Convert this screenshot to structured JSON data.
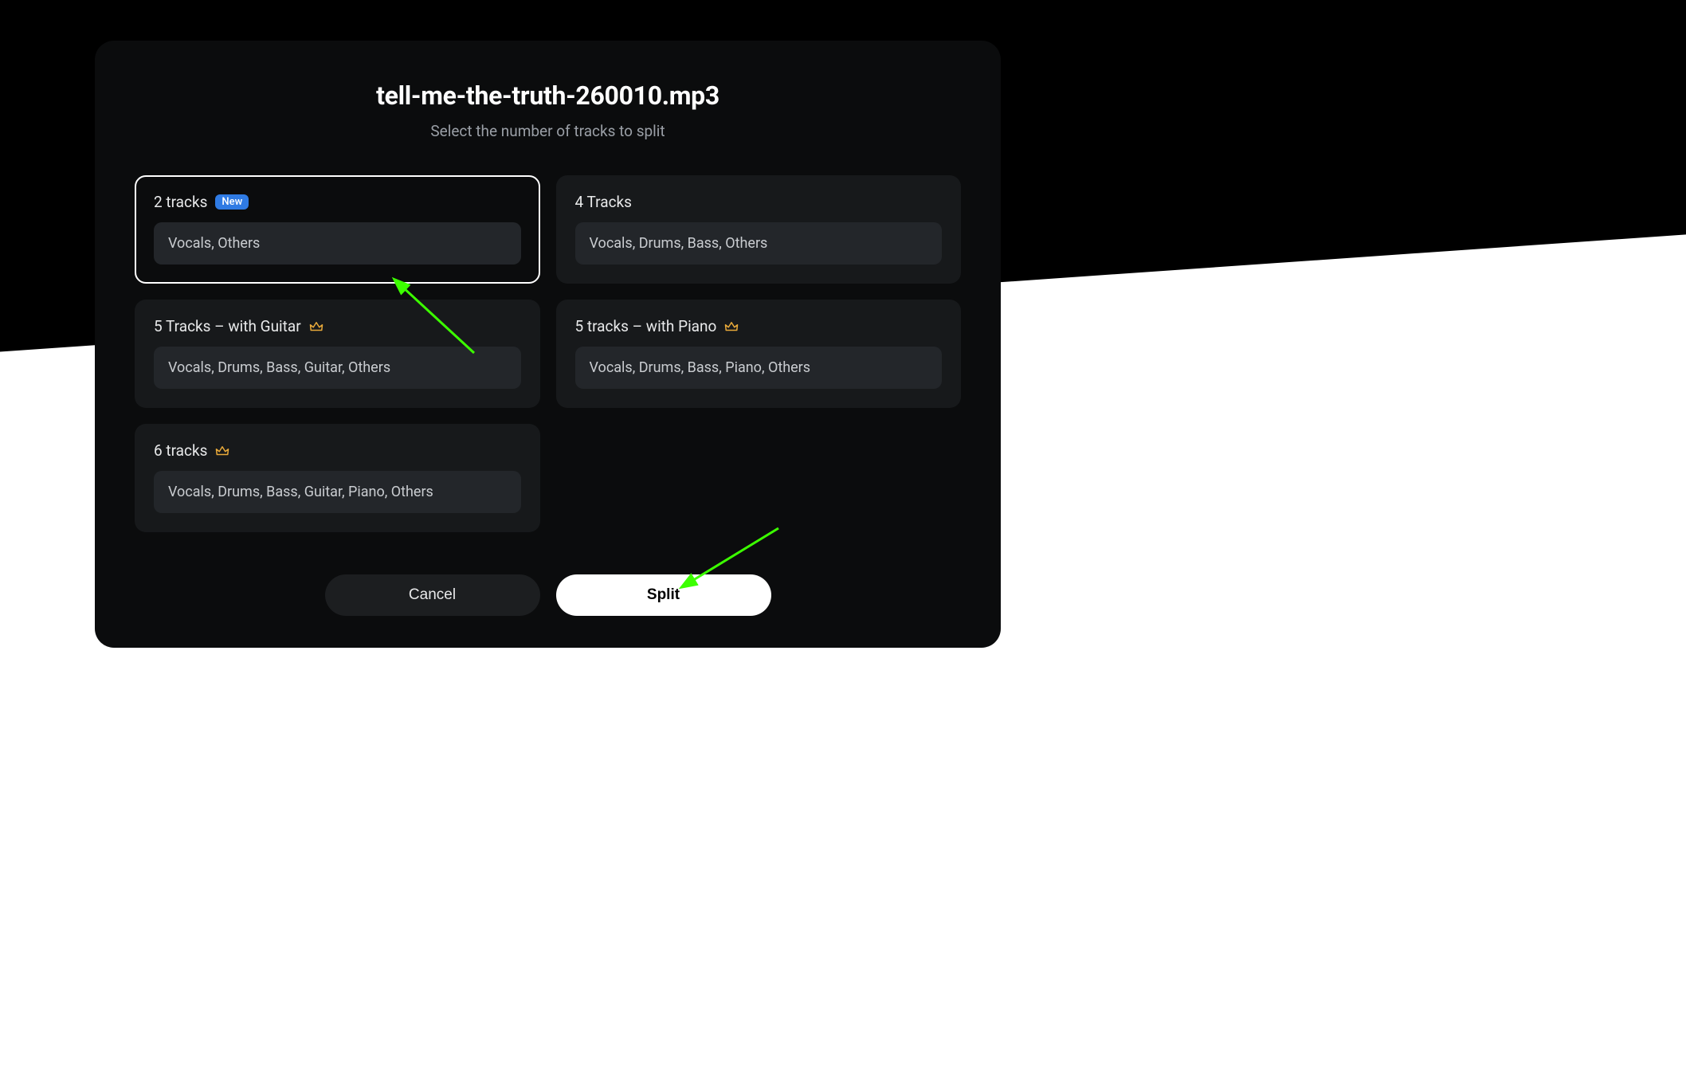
{
  "modal": {
    "title": "tell-me-the-truth-260010.mp3",
    "subtitle": "Select the number of tracks to split"
  },
  "options": [
    {
      "title": "2 tracks",
      "badge": "New",
      "premium": false,
      "desc": "Vocals, Others",
      "selected": true
    },
    {
      "title": "4 Tracks",
      "badge": null,
      "premium": false,
      "desc": "Vocals, Drums, Bass, Others",
      "selected": false
    },
    {
      "title": "5 Tracks – with Guitar",
      "badge": null,
      "premium": true,
      "desc": "Vocals, Drums, Bass, Guitar, Others",
      "selected": false
    },
    {
      "title": "5 tracks – with Piano",
      "badge": null,
      "premium": true,
      "desc": "Vocals, Drums, Bass, Piano, Others",
      "selected": false
    },
    {
      "title": "6 tracks",
      "badge": null,
      "premium": true,
      "desc": "Vocals, Drums, Bass, Guitar, Piano, Others",
      "selected": false
    }
  ],
  "footer": {
    "cancel_label": "Cancel",
    "split_label": "Split"
  },
  "colors": {
    "badge_bg": "#2f7be4",
    "crown": "#e8a93a",
    "arrow": "#3cff00"
  }
}
